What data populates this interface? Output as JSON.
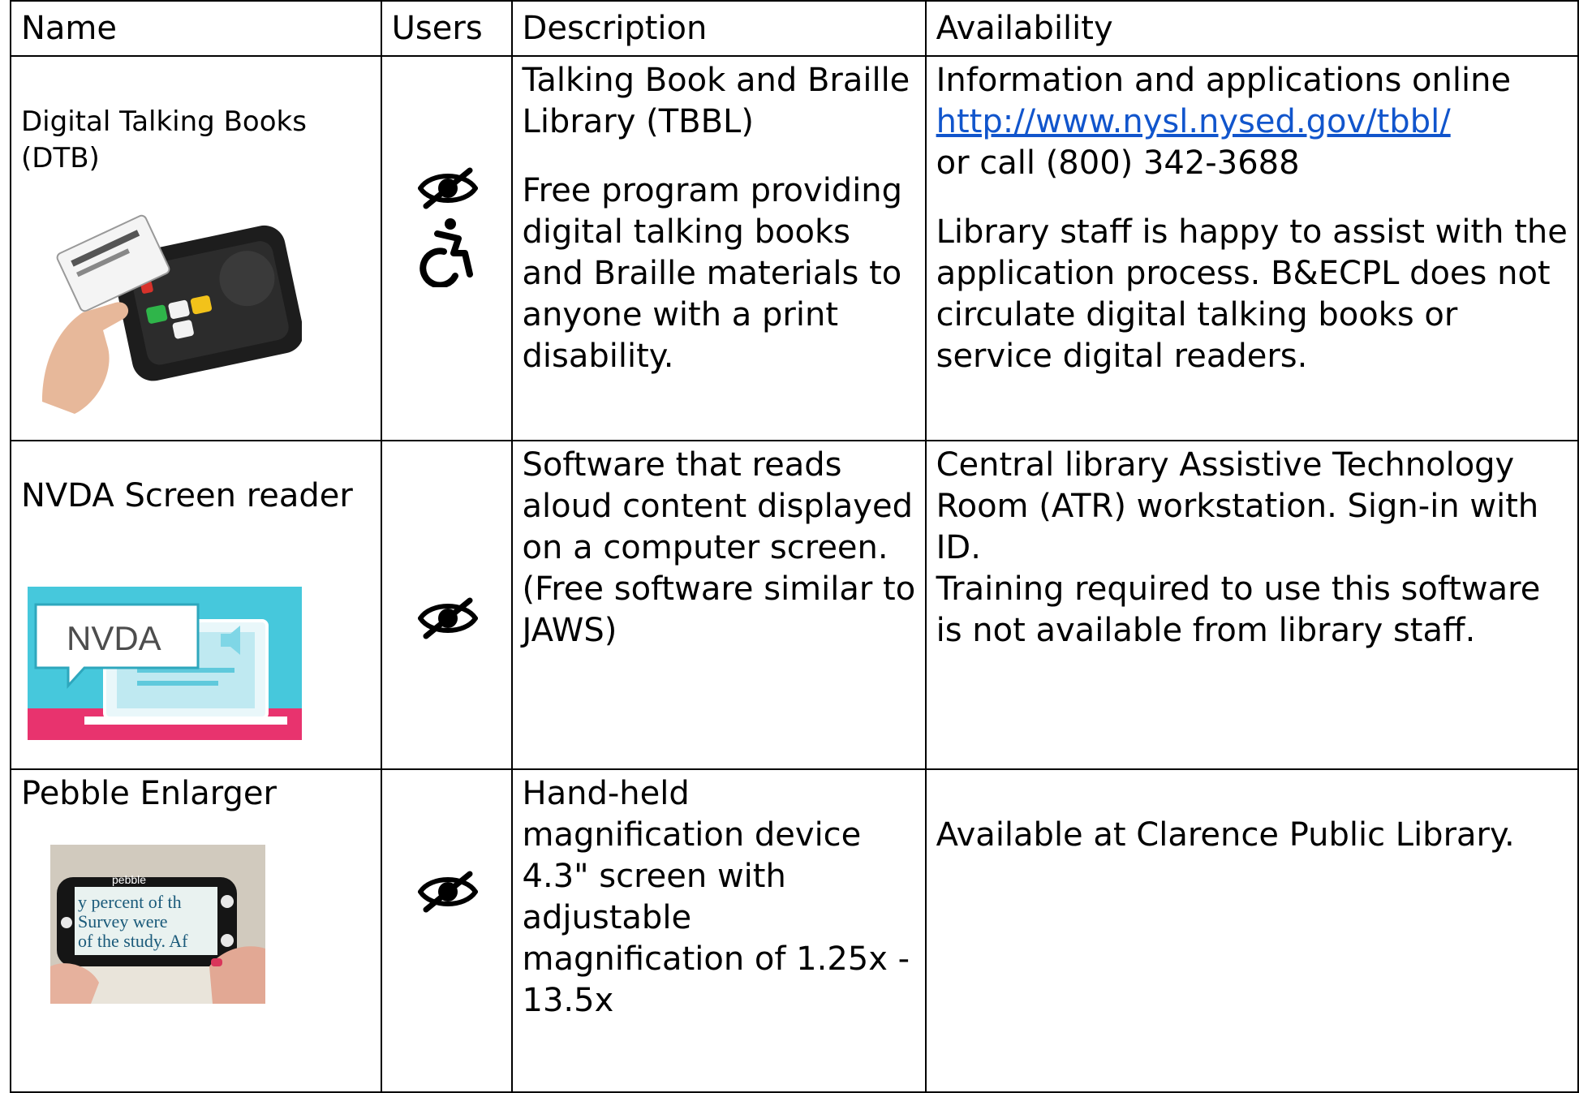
{
  "headers": {
    "name": "Name",
    "users": "Users",
    "description": "Description",
    "availability": "Availability"
  },
  "rows": [
    {
      "name": "Digital Talking Books (DTB)",
      "description_title": "Talking Book and Braille Library (TBBL)",
      "description_body": "Free program providing digital talking books and Braille materials to anyone with a print disability.",
      "availability_intro": "Information and applications online",
      "availability_link": "http://www.nysl.nysed.gov/tbbl/",
      "availability_phone": "or call (800) 342-3688",
      "availability_note": "Library staff is happy to assist with the application process. B&ECPL does not circulate digital talking books or service digital readers.",
      "users_icons": [
        "eye-slash-icon",
        "wheelchair-icon"
      ]
    },
    {
      "name": "NVDA Screen reader",
      "description": "Software that reads aloud content displayed on a computer screen. (Free software similar to JAWS)",
      "availability_line1": "Central library Assistive Technology Room (ATR) workstation. Sign-in with ID.",
      "availability_line2": "Training required to use this software is not available from library staff.",
      "image_text": "NVDA",
      "users_icons": [
        "eye-slash-icon"
      ]
    },
    {
      "name": "Pebble Enlarger",
      "description": "Hand-held magnification device 4.3\" screen with adjustable magnification of 1.25x - 13.5x",
      "availability": "Available at Clarence Public Library.",
      "image_brand": "pebble",
      "image_text_lines": [
        "y percent of th",
        "Survey were",
        "of the study. Af"
      ],
      "users_icons": [
        "eye-slash-icon"
      ]
    }
  ],
  "colors": {
    "link": "#1155cc",
    "nvda_bg": "#46c8dc",
    "nvda_band": "#e8336e"
  }
}
